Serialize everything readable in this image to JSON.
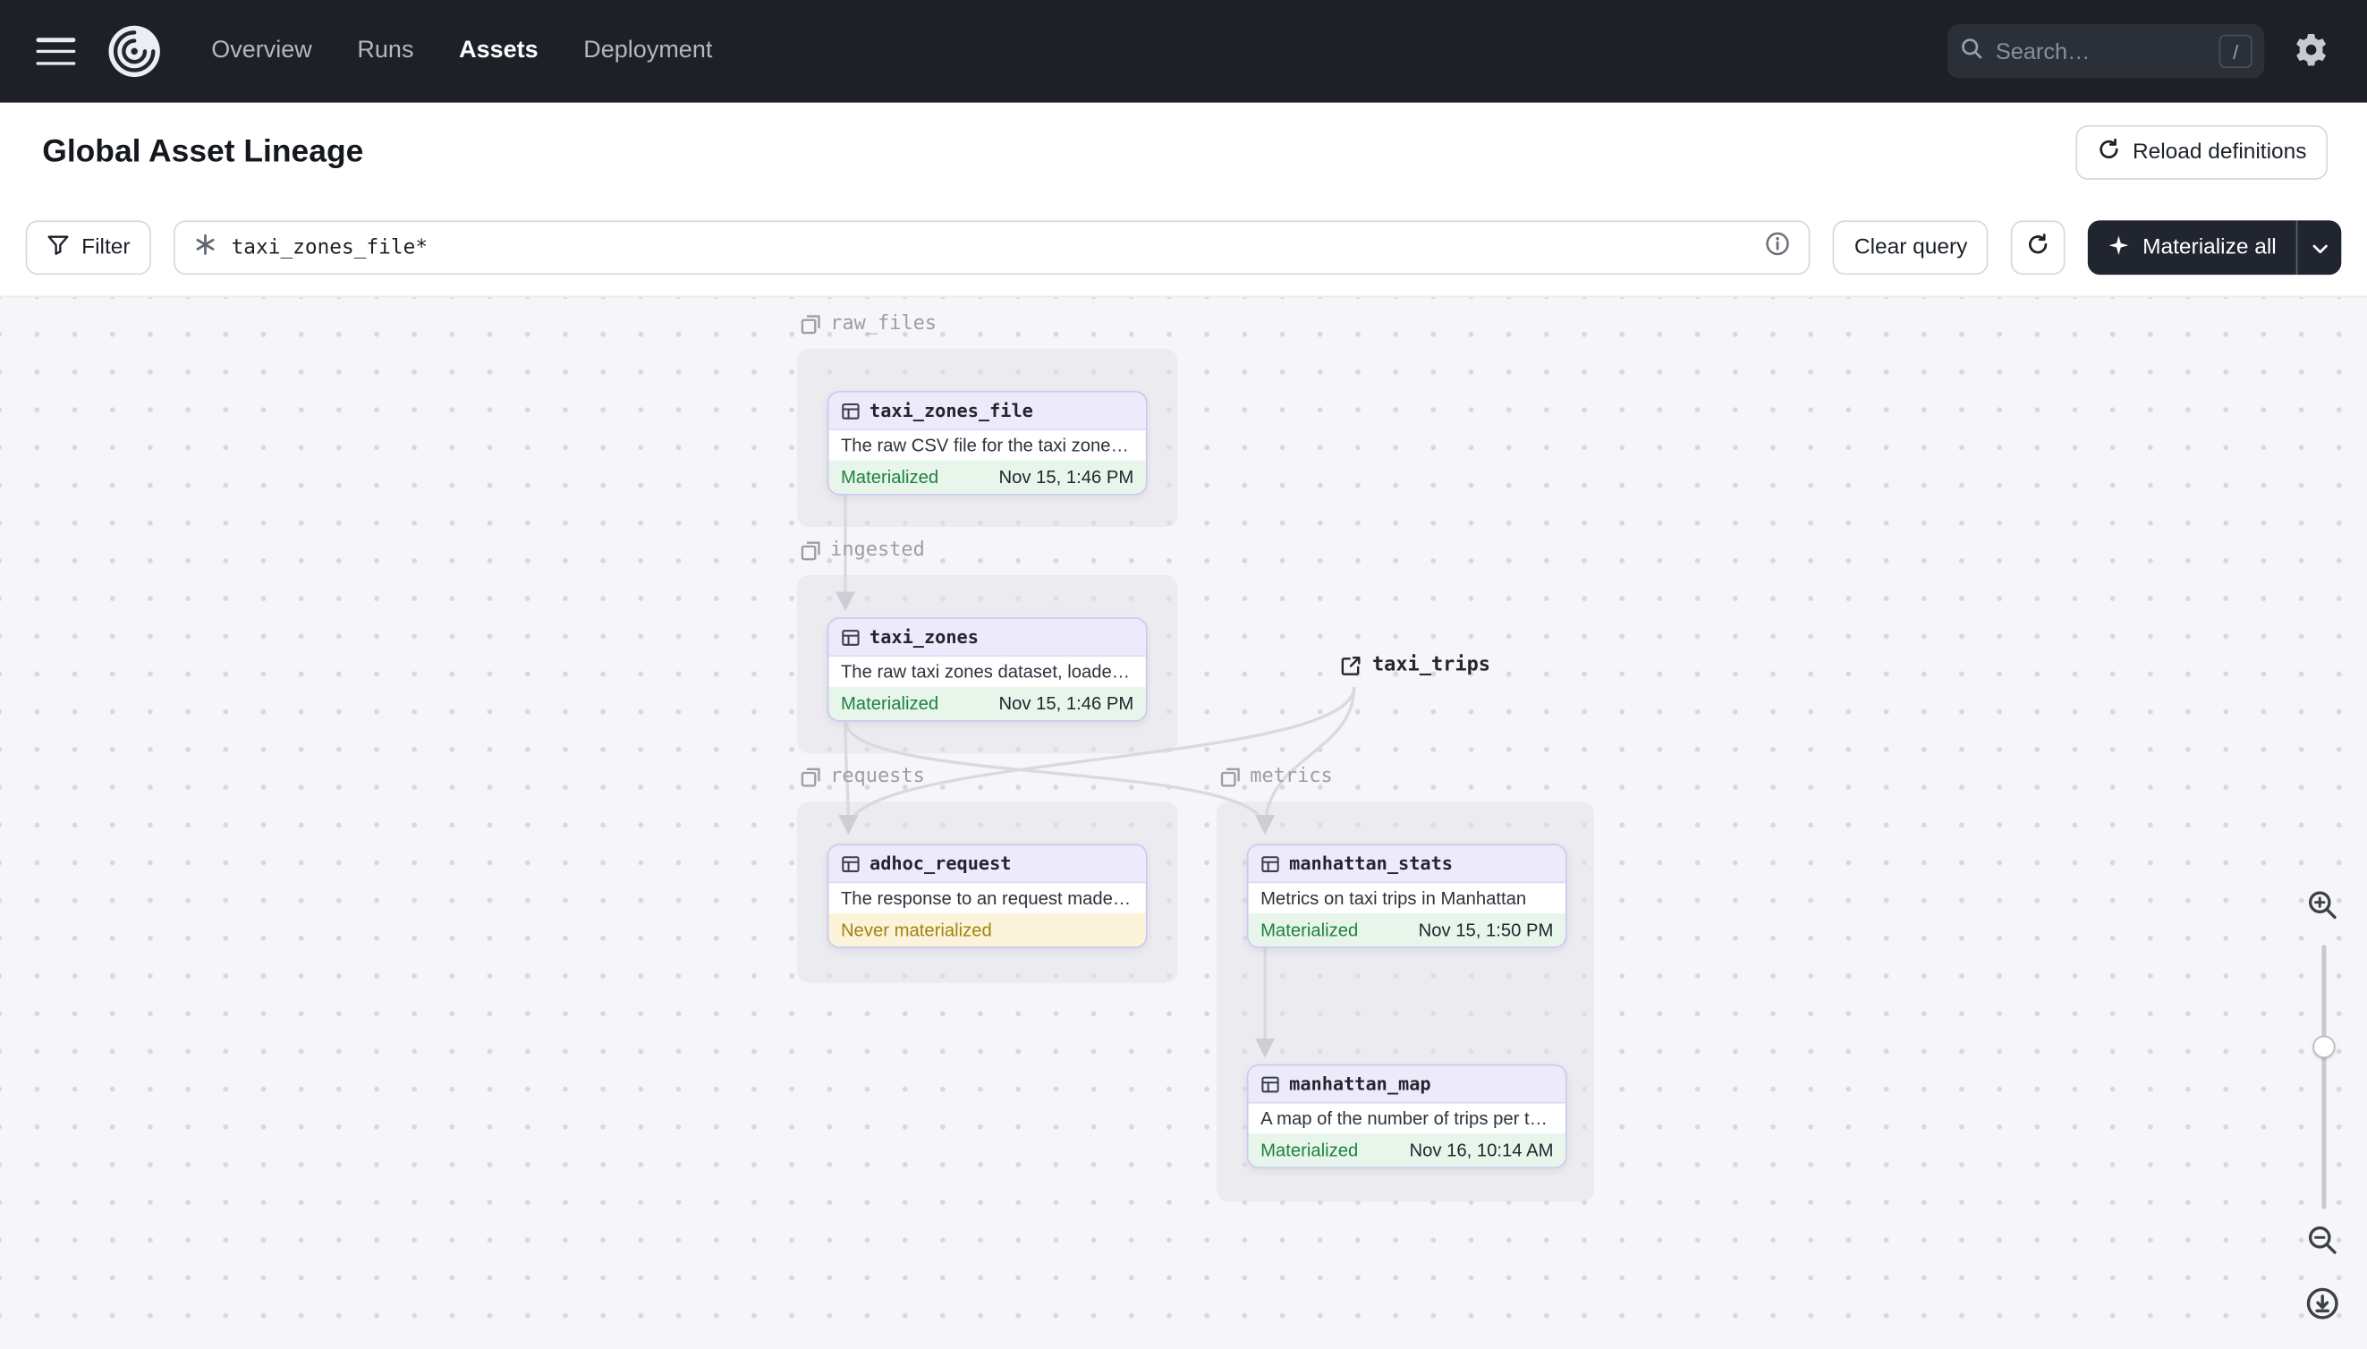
{
  "navbar": {
    "links": [
      {
        "label": "Overview"
      },
      {
        "label": "Runs"
      },
      {
        "label": "Assets"
      },
      {
        "label": "Deployment"
      }
    ],
    "search": {
      "placeholder": "Search…",
      "shortcut": "/"
    }
  },
  "header": {
    "title": "Global Asset Lineage",
    "reload_button_label": "Reload definitions"
  },
  "toolbar": {
    "filter_label": "Filter",
    "query_value": "taxi_zones_file*",
    "clear_query_label": "Clear query",
    "materialize_all_label": "Materialize all"
  },
  "graph": {
    "groups": [
      {
        "name": "raw_files"
      },
      {
        "name": "ingested"
      },
      {
        "name": "requests"
      },
      {
        "name": "metrics"
      }
    ],
    "nodes": [
      {
        "name": "taxi_zones_file",
        "group": "raw_files",
        "description": "The raw CSV file for the taxi zones dat...",
        "status": "Materialized",
        "timestamp": "Nov 15, 1:46 PM"
      },
      {
        "name": "taxi_zones",
        "group": "ingested",
        "description": "The raw taxi zones dataset, loaded int...",
        "status": "Materialized",
        "timestamp": "Nov 15, 1:46 PM"
      },
      {
        "name": "adhoc_request",
        "group": "requests",
        "description": "The response to an request made in th...",
        "status": "Never materialized",
        "timestamp": ""
      },
      {
        "name": "manhattan_stats",
        "group": "metrics",
        "description": "Metrics on taxi trips in Manhattan",
        "status": "Materialized",
        "timestamp": "Nov 15, 1:50 PM"
      },
      {
        "name": "manhattan_map",
        "group": "metrics",
        "description": "A map of the number of trips per taxi z...",
        "status": "Materialized",
        "timestamp": "Nov 16, 10:14 AM"
      }
    ],
    "external_assets": [
      {
        "name": "taxi_trips"
      }
    ]
  },
  "colors": {
    "navbar_bg": "#1d2027",
    "accent_purple_border": "#cbc7f0",
    "node_header_bg": "#eceafb",
    "materialized_green": "#1e8140",
    "materialized_bg": "#e7f5ea",
    "never_materialized_yellow": "#a2830f",
    "never_materialized_bg": "#fbf3da",
    "canvas_bg": "#f6f6f8",
    "dark_button_bg": "#20252f"
  }
}
